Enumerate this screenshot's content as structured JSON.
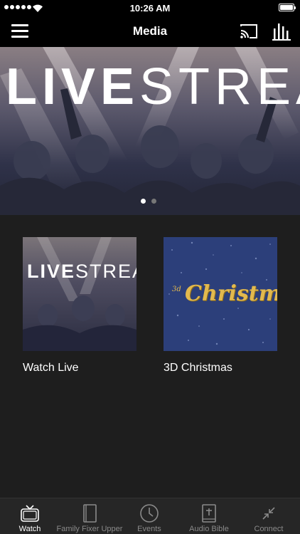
{
  "status_bar": {
    "time": "10:26 AM"
  },
  "nav": {
    "title": "Media"
  },
  "hero": {
    "title_bold": "LIVE",
    "title_light": "STREAM",
    "page_count": 2,
    "active_page": 1
  },
  "media_items": [
    {
      "thumb_text_bold": "LIVE",
      "thumb_text_light": "STREAM",
      "label": "Watch Live"
    },
    {
      "thumb_text_small": "3d",
      "thumb_text_script": "Christmas",
      "label": "3D Christmas"
    }
  ],
  "tabs": [
    {
      "label": "Watch",
      "icon": "tv-icon",
      "active": true
    },
    {
      "label": "Family Fixer Upper",
      "icon": "book-icon",
      "active": false
    },
    {
      "label": "Events",
      "icon": "clock-icon",
      "active": false
    },
    {
      "label": "Audio Bible",
      "icon": "bible-icon",
      "active": false
    },
    {
      "label": "Connect",
      "icon": "connect-icon",
      "active": false
    }
  ],
  "colors": {
    "background": "#1e1e1e",
    "bar": "#000000",
    "tab_active": "#ffffff",
    "tab_inactive": "#8a8a8a",
    "dot_active": "#ffffff",
    "dot_inactive": "#777777",
    "xmas_gold": "#e2b94e",
    "xmas_blue": "#2c3f7a"
  }
}
